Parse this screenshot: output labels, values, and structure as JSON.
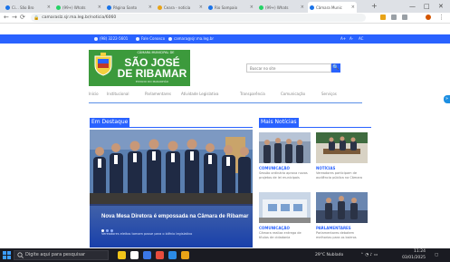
{
  "browser": {
    "tabs": [
      {
        "label": "Ci... São Bro",
        "color": "#1a73e8"
      },
      {
        "label": "(99+) Whats",
        "color": "#25d366"
      },
      {
        "label": "Página Santo",
        "color": "#1a73e8"
      },
      {
        "label": "Ceara - noticia",
        "color": "#e8a317"
      },
      {
        "label": "Rio Sampaio",
        "color": "#1a73e8"
      },
      {
        "label": "(99+) Whats",
        "color": "#25d366"
      },
      {
        "label": "Câmara Munic",
        "color": "#1a73e8"
      }
    ],
    "new_tab": "+",
    "window_controls": {
      "minimize": "—",
      "maximize": "□",
      "close": "✕"
    },
    "address": "camaraslz.sjr.ma.leg.br/noticia/6060",
    "back": "←",
    "forward": "→",
    "reload": "⟳"
  },
  "site": {
    "utility_bar": {
      "items": [
        "(98) 3222-5601",
        "Fale Conosco",
        "camara@sjr.ma.leg.br"
      ],
      "right_links": [
        "A+",
        "A-",
        "AC"
      ]
    },
    "logo": {
      "kicker": "CÂMARA MUNICIPAL DE",
      "name_line1": "SÃO JOSÉ",
      "name_line2": "DE RIBAMAR",
      "tagline": "ESTADO DO MARANHÃO"
    },
    "search": {
      "placeholder": "Buscar no site",
      "button": "🔍"
    },
    "menu": [
      "Início",
      "Institucional",
      "Parlamentares",
      "Atividade Legislativa",
      "Transparência",
      "Comunicação",
      "Serviços"
    ],
    "edge_tab": "»",
    "featured": {
      "section": "Em Destaque",
      "headline": "Nova Mesa Diretora é empossada na Câmara de Ribamar",
      "caption": "Vereadores eleitos tomam posse para o biênio legislativo"
    },
    "news": {
      "section": "Mais Notícias",
      "items": [
        {
          "title": "COMUNICAÇÃO",
          "summary": "Sessão ordinária aprova novos projetos de lei municipais"
        },
        {
          "title": "NOTÍCIAS",
          "summary": "Vereadores participam de audiência pública na Câmara"
        },
        {
          "title": "COMUNICAÇÃO",
          "summary": "Câmara realiza entrega de títulos de cidadania"
        },
        {
          "title": "PARLAMENTARES",
          "summary": "Parlamentares debatem melhorias para os bairros"
        }
      ]
    }
  },
  "taskbar": {
    "search_placeholder": "Digite aqui para pesquisar",
    "app_colors": [
      "#f0c419",
      "#ffffff",
      "#3b78e7",
      "#e84c3d",
      "#2b8be6",
      "#e8a317"
    ],
    "weather": "29°C Nublado",
    "time": "11:24",
    "date": "03/01/2025"
  },
  "colors": {
    "brand_blue": "#2962ff",
    "logo_green": "#3c9a3c",
    "taskbar": "#1a1b22"
  }
}
